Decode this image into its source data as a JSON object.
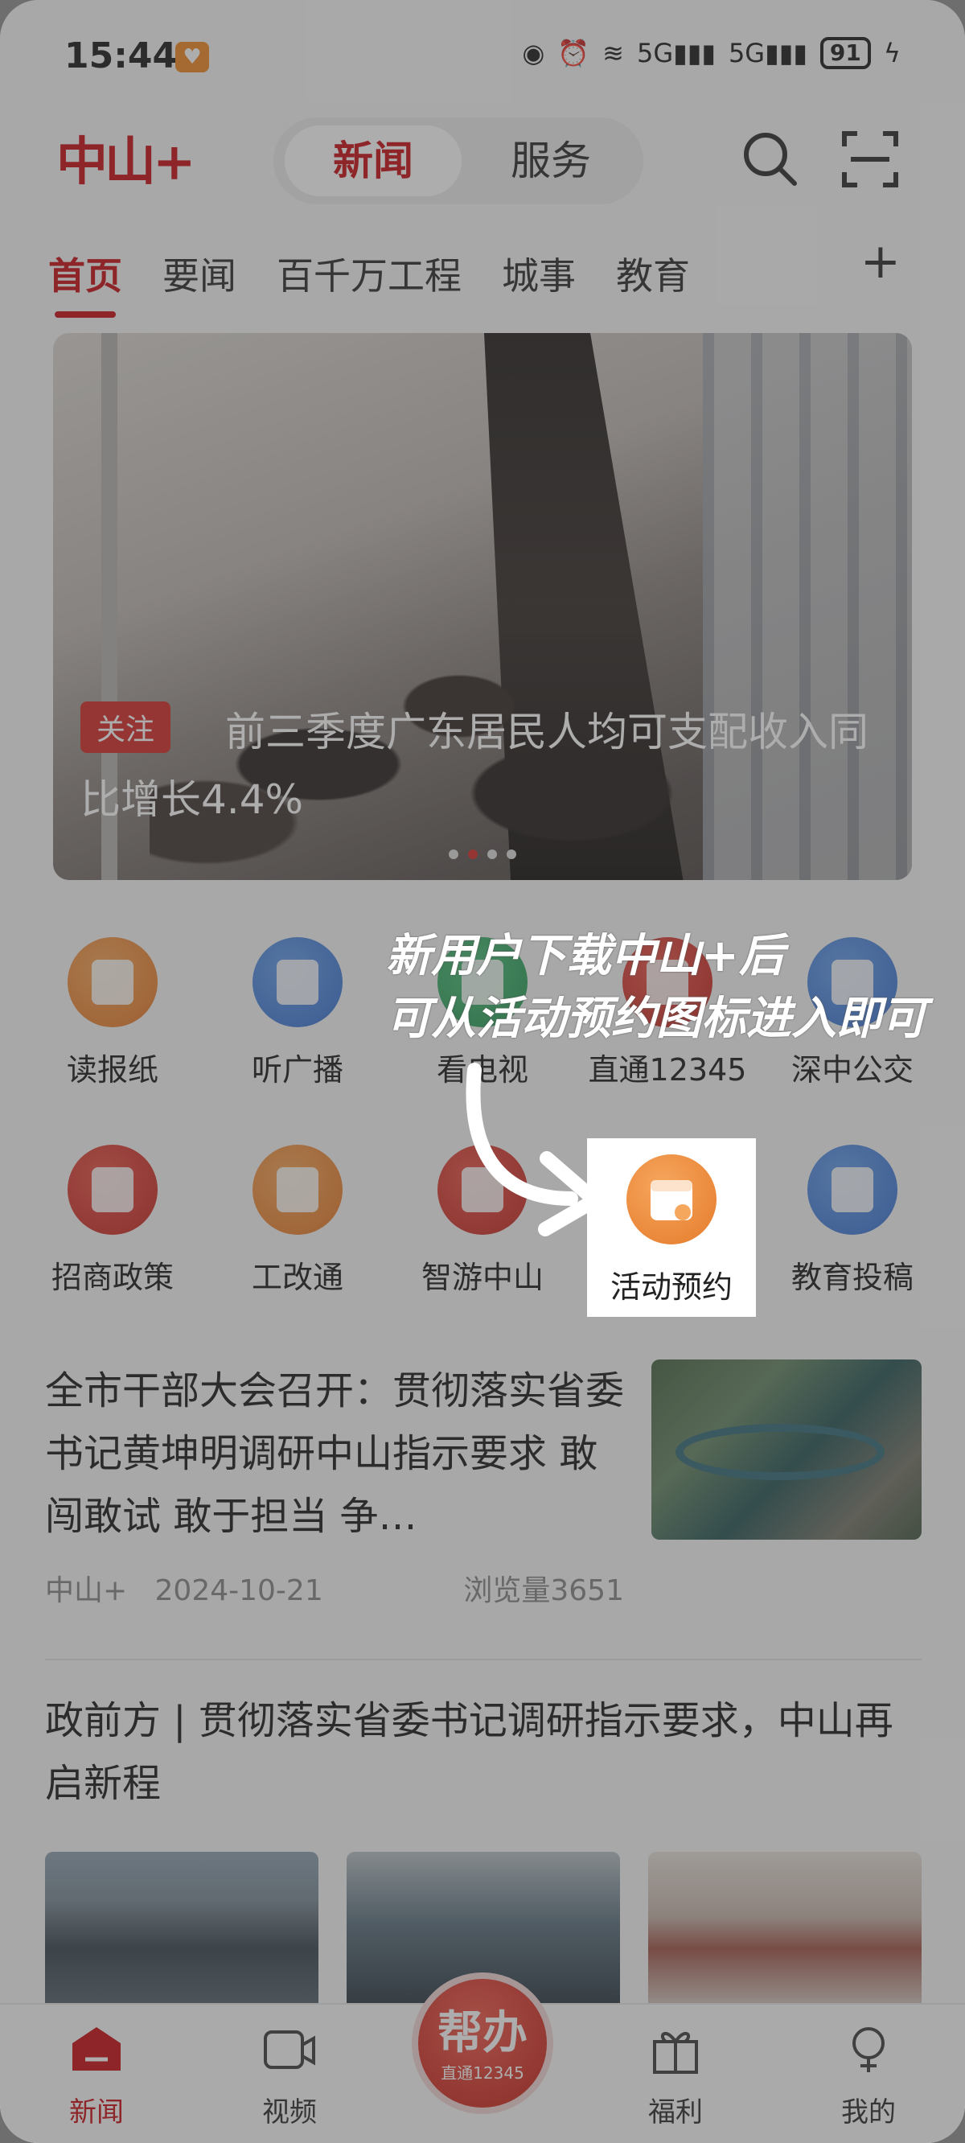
{
  "status_bar": {
    "time": "15:44",
    "network_1": "5G",
    "network_2": "5G",
    "battery": "91"
  },
  "header": {
    "logo": "中山+",
    "segment_active": "新闻",
    "segment_inactive": "服务",
    "icons": [
      "search-icon",
      "scan-icon"
    ]
  },
  "tabs": [
    {
      "label": "首页"
    },
    {
      "label": "要闻"
    },
    {
      "label": "百千万工程"
    },
    {
      "label": "城事"
    },
    {
      "label": "教育"
    }
  ],
  "banner": {
    "tag": "关注",
    "title": "前三季度广东居民人均可支配收入同比增长4.4%",
    "active_slide": 2,
    "slide_count": 4
  },
  "shortcuts": {
    "row1": [
      {
        "label": "读报纸",
        "icon": "newspaper-icon",
        "color": "#e57a2a"
      },
      {
        "label": "听广播",
        "icon": "radio-icon",
        "color": "#3d74d2"
      },
      {
        "label": "看电视",
        "icon": "tv-icon",
        "color": "#2b9c5a"
      },
      {
        "label": "直通12345",
        "icon": "hotline-icon",
        "color": "#c52b25"
      },
      {
        "label": "深中公交",
        "icon": "bus-icon",
        "color": "#3d74d2"
      }
    ],
    "row2": [
      {
        "label": "招商政策",
        "icon": "policy-icon",
        "color": "#c52b25"
      },
      {
        "label": "工改通",
        "icon": "reform-icon",
        "color": "#e57a2a"
      },
      {
        "label": "智游中山",
        "icon": "travel-icon",
        "color": "#c52b25"
      },
      {
        "label": "活动预约",
        "icon": "calendar-icon",
        "color": "#e57a2a"
      },
      {
        "label": "教育投稿",
        "icon": "mail-icon",
        "color": "#3d74d2"
      }
    ]
  },
  "annotation": {
    "line1": "新用户下载中山+后",
    "line2": "可从活动预约图标进入即可"
  },
  "articles": [
    {
      "title": "全市干部大会召开：贯彻落实省委书记黄坤明调研中山指示要求 敢闯敢试 敢于担当 争…",
      "source": "中山+",
      "date": "2024-10-21",
      "views": "浏览量3651"
    },
    {
      "title": "政前方 | 贯彻落实省委书记调研指示要求，中山再启新程"
    }
  ],
  "bottom_nav": [
    {
      "label": "新闻",
      "icon": "news-icon",
      "active": true
    },
    {
      "label": "视频",
      "icon": "video-icon",
      "active": false
    },
    {
      "label": "福利",
      "icon": "gift-icon",
      "active": false
    },
    {
      "label": "我的",
      "icon": "profile-icon",
      "active": false
    }
  ],
  "help_button": {
    "main": "帮办",
    "sub": "直通12345"
  },
  "colors": {
    "brand_red": "#c8161d",
    "accent_orange": "#e57a2a"
  }
}
